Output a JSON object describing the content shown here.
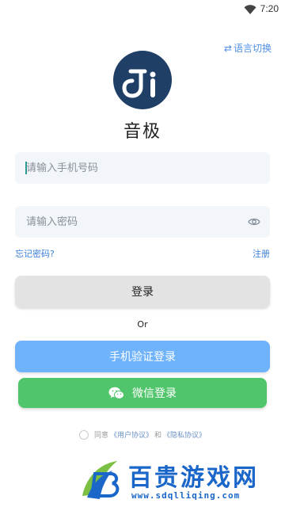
{
  "status_bar": {
    "time": "7:20",
    "wifi_icon": "wifi-icon"
  },
  "language_switch": {
    "icon": "swap-icon",
    "label": "语言切换"
  },
  "logo": {
    "icon": "app-logo-icon",
    "color": "#1f3f67"
  },
  "app_name": "音极",
  "phone_field": {
    "placeholder": "请输入手机号码",
    "value": ""
  },
  "password_field": {
    "placeholder": "请输入密码",
    "value": "",
    "eye_icon": "eye-icon"
  },
  "links": {
    "forgot_password": "忘记密码?",
    "register": "注册"
  },
  "buttons": {
    "login": "登录",
    "phone_login": "手机验证登录",
    "wechat_login": "微信登录",
    "wechat_icon": "wechat-icon"
  },
  "or_text": "Or",
  "agreement": {
    "agree": "同意",
    "user_agreement": "《用户协议》",
    "and": "和",
    "privacy_agreement": "《隐私协议》",
    "checked": false
  },
  "watermark": {
    "title": "百贵游戏网",
    "url": "www.sdqlliqing.com"
  },
  "colors": {
    "accent": "#4f8fe8",
    "phone_button": "#6eb3fb",
    "wechat_button": "#50c56b",
    "login_button": "#e3e3e3",
    "field_bg": "#f2f6fb"
  }
}
